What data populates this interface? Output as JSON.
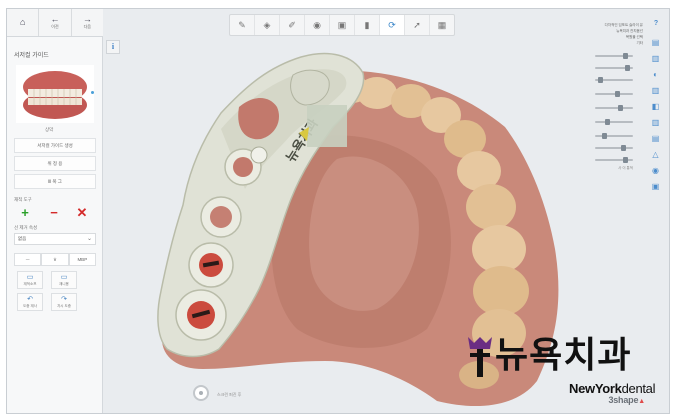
{
  "colors": {
    "accent_blue": "#3a86c8",
    "add_green": "#2aa02a",
    "remove_red": "#d42a2a",
    "gum_pink": "#c9897a",
    "tooth": "#e7c8a0",
    "splint": "#e0e2d6",
    "watermark_purple": "#6b2d83"
  },
  "left_nav": {
    "buttons": [
      {
        "name": "home",
        "icon": "home-icon",
        "label": ""
      },
      {
        "name": "back",
        "icon": "arrow-left-icon",
        "label": "이전"
      },
      {
        "name": "next",
        "icon": "arrow-right-icon",
        "label": "다음"
      }
    ]
  },
  "left_panel": {
    "title": "서저컬 가이드",
    "thumb_caption": "상악",
    "menu_items": [
      "서저컬 가이드 생성",
      "위 정 용",
      "Ⅲ 복 그"
    ],
    "edit_section_label": "재적 도구",
    "option_label": "선 제거 속성",
    "dropdown_value": "없음",
    "segments": [
      "ㅡ",
      "ㅎ",
      "MBP"
    ],
    "tiles_row1": [
      "재적소프",
      "재니용"
    ],
    "tiles_row2": [
      "도중 재사",
      "자시 도중"
    ]
  },
  "info_button": "i",
  "top_toolbar": {
    "buttons": [
      {
        "name": "view-mode",
        "icon": "pen-icon"
      },
      {
        "name": "surface",
        "icon": "model-icon"
      },
      {
        "name": "annotate",
        "icon": "brush-icon"
      },
      {
        "name": "implant",
        "icon": "tooth-icon"
      },
      {
        "name": "sleeve",
        "icon": "cube-icon"
      },
      {
        "name": "measure",
        "icon": "ruler-icon"
      },
      {
        "name": "screenshot",
        "icon": "camera-icon"
      },
      {
        "name": "export",
        "icon": "arrow-icon"
      },
      {
        "name": "layout",
        "icon": "grid-icon"
      }
    ],
    "active_index": 6
  },
  "right_panel": {
    "help_label": "?",
    "lines": [
      "다차적인 임포트 슬라이 유",
      "뉴욕치과 잔치봅넌",
      "복원물 선택",
      "기타"
    ],
    "sliders": [
      0.85,
      0.9,
      0.1,
      0.6,
      0.7,
      0.3,
      0.2,
      0.8,
      0.85
    ],
    "check_label": "사 이 통적",
    "icons": [
      "panel-icon",
      "layers-icon",
      "tooth-icon",
      "layers-icon",
      "pencil-icon",
      "layers-icon",
      "cone-icon",
      "eye-icon",
      "square-icon"
    ]
  },
  "bottom": {
    "label": "스크린 퍼진 후",
    "brand": "3shape"
  },
  "watermark": {
    "korean": "뉴욕치과",
    "english_bold": "NewYork",
    "english_light": "dental"
  },
  "model_text": "뉴욕치과"
}
